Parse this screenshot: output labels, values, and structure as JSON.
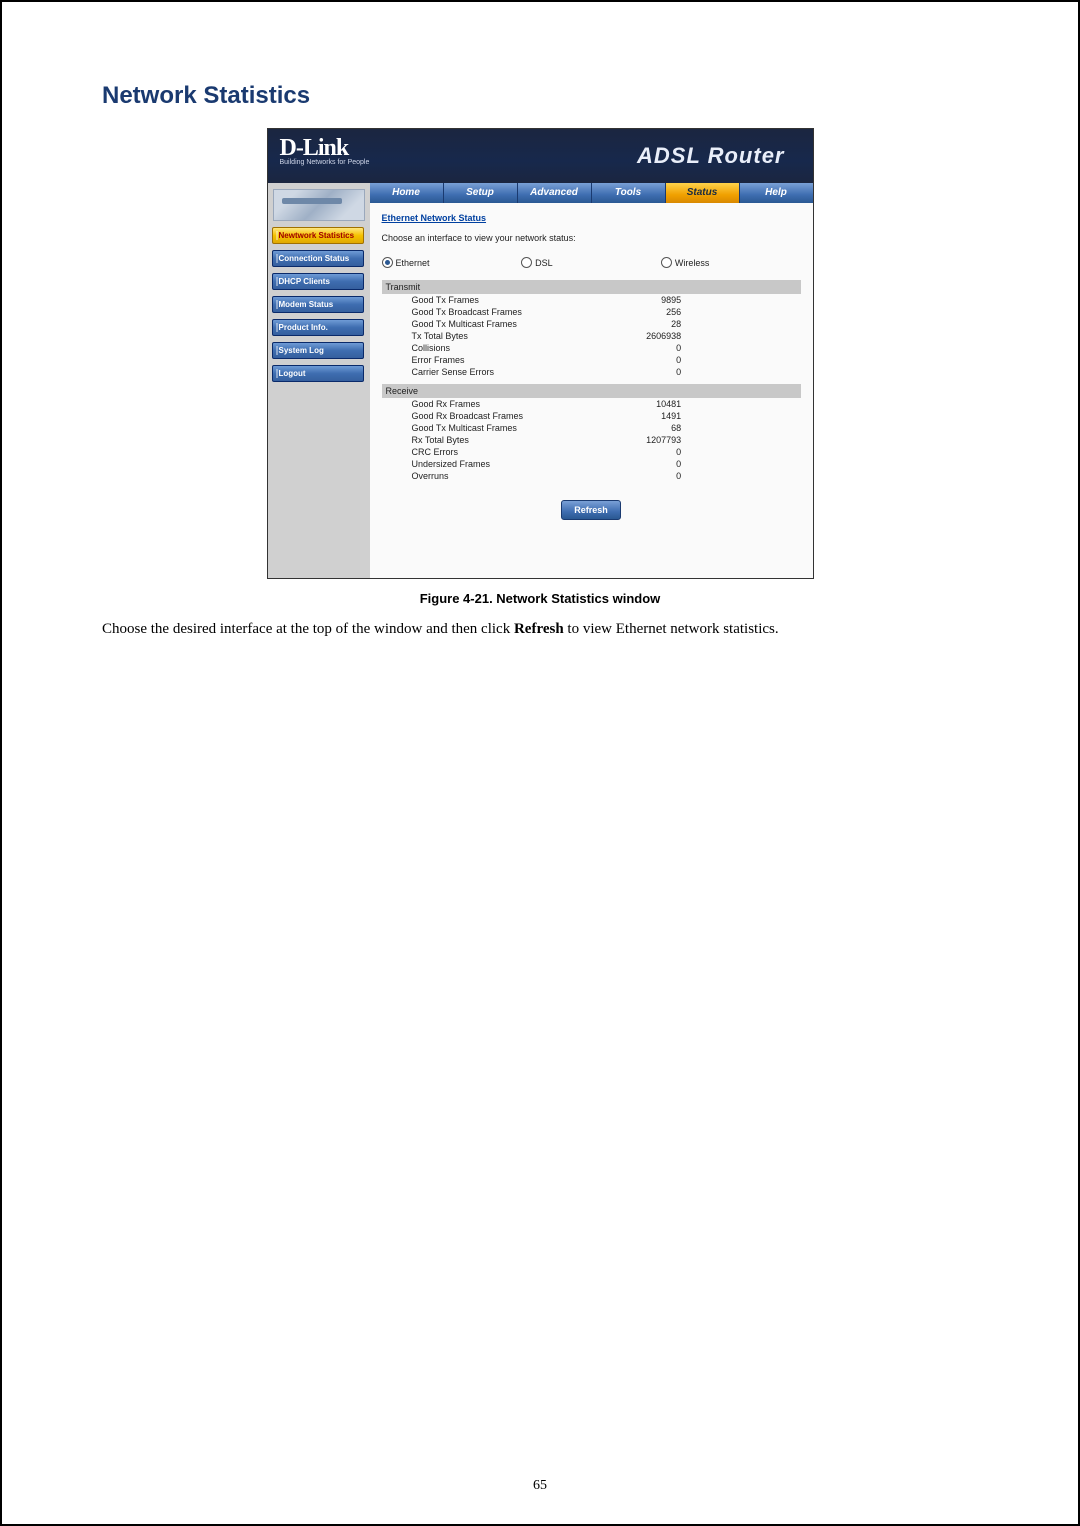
{
  "doc_title": "Network Statistics",
  "banner": {
    "brand": "D-Link",
    "tagline": "Building Networks for People",
    "title": "ADSL Router"
  },
  "tabs": [
    "Home",
    "Setup",
    "Advanced",
    "Tools",
    "Status",
    "Help"
  ],
  "sidebar": {
    "items": [
      "Newtwork Statistics",
      "Connection Status",
      "DHCP Clients",
      "Modem Status",
      "Product Info.",
      "System Log",
      "Logout"
    ]
  },
  "content": {
    "heading": "Ethernet Network Status",
    "instruction": "Choose an interface to view your network status:",
    "radios": {
      "ethernet": "Ethernet",
      "dsl": "DSL",
      "wireless": "Wireless"
    },
    "transmit_header": "Transmit",
    "receive_header": "Receive",
    "transmit": [
      {
        "label": "Good Tx Frames",
        "value": "9895"
      },
      {
        "label": "Good Tx Broadcast Frames",
        "value": "256"
      },
      {
        "label": "Good Tx Multicast Frames",
        "value": "28"
      },
      {
        "label": "Tx Total Bytes",
        "value": "2606938"
      },
      {
        "label": "Collisions",
        "value": "0"
      },
      {
        "label": "Error Frames",
        "value": "0"
      },
      {
        "label": "Carrier Sense Errors",
        "value": "0"
      }
    ],
    "receive": [
      {
        "label": "Good Rx Frames",
        "value": "10481"
      },
      {
        "label": "Good Rx Broadcast Frames",
        "value": "1491"
      },
      {
        "label": "Good Tx Multicast Frames",
        "value": "68"
      },
      {
        "label": "Rx Total Bytes",
        "value": "1207793"
      },
      {
        "label": "CRC Errors",
        "value": "0"
      },
      {
        "label": "Undersized Frames",
        "value": "0"
      },
      {
        "label": "Overruns",
        "value": "0"
      }
    ],
    "refresh": "Refresh"
  },
  "figure_caption": "Figure 4-21. Network Statistics window",
  "body_text_prefix": "Choose the desired interface at the top of the window and then click ",
  "body_text_bold": "Refresh",
  "body_text_suffix": " to view Ethernet network statistics.",
  "page_number": "65"
}
